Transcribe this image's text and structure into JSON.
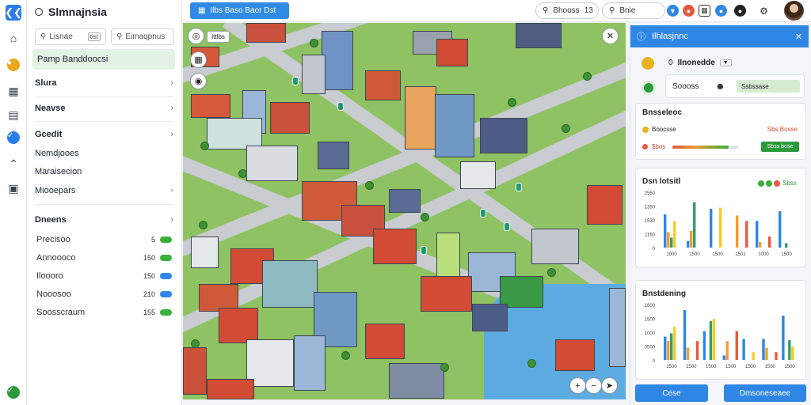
{
  "app": {
    "title": "Slmnajnsia"
  },
  "sidebar": {
    "search_left": "Lisnae",
    "search_left_chip": "tist",
    "search_right": "Eimaqpnus",
    "selected": "Pamp Banddoocsi",
    "nav": [
      {
        "label": "Slura",
        "bold": true,
        "chevron": true
      },
      {
        "label": "Neavse",
        "bold": true,
        "chevron": true
      },
      {
        "label": "Gcedit",
        "bold": true,
        "chevron": true
      },
      {
        "label": "Nemdjooes",
        "bold": false,
        "chevron": false
      },
      {
        "label": "Maraisecion",
        "bold": false,
        "chevron": false
      },
      {
        "label": "Miooepars",
        "bold": false,
        "chevron": true
      },
      {
        "label": "Dneens",
        "bold": true,
        "chevron": true
      }
    ],
    "list": [
      {
        "label": "Precisoo",
        "value": "5",
        "color": "#3cae3c"
      },
      {
        "label": "Annoooco",
        "value": "150",
        "color": "#3cae3c"
      },
      {
        "label": "Iloooro",
        "value": "150",
        "color": "#2f86e4"
      },
      {
        "label": "Nooosoo",
        "value": "210",
        "color": "#2f86e4"
      },
      {
        "label": "Soosscraum",
        "value": "155",
        "color": "#3cae3c"
      }
    ]
  },
  "header": {
    "primary_button": "Ilbs Baso Baor Dst",
    "search1": "Bhooss",
    "search1_num": "13",
    "search2": "Bnie"
  },
  "map": {
    "label": "Ittlbs",
    "left_controls": [
      "location-icon",
      "layers-icon",
      "pin-icon"
    ],
    "bottom_controls": [
      "zoom-in-icon",
      "zoom-out-icon",
      "compass-icon"
    ]
  },
  "panel": {
    "title": "Ilhlasjnnc",
    "dropdown_label": "Ilnonedde",
    "dropdown_num": "0",
    "field1": "Soooss",
    "field2": "Ssbssase",
    "info_title": "Bnsseleoc",
    "row1_left": "Boocsse",
    "row1_right": "Sbs Bosse",
    "row2_left": "$bos",
    "row2_button": "Sbss bose",
    "progress": 0.85,
    "chart1_title": "Dsn lotsitl",
    "chart1_legend": "Sbss",
    "chart2_title": "Bnstdening",
    "buttons": [
      "Cese",
      "Dmsoneseaee"
    ]
  },
  "chart_data": [
    {
      "type": "bar",
      "title": "Dsn lotsitl",
      "yticks": [
        "2550",
        "1350",
        "1530",
        "1150",
        "0"
      ],
      "categories": [
        "1000",
        "1500",
        "1500",
        "1501",
        "1000",
        "1500"
      ],
      "ylim": [
        0,
        100
      ],
      "series": [
        {
          "name": "Sbss",
          "color": "#2f86e4",
          "values": [
            60,
            12,
            70,
            0,
            48,
            66
          ]
        },
        {
          "color": "#f39c34",
          "values": [
            28,
            30,
            0,
            58,
            10,
            0
          ]
        },
        {
          "color": "#2ea06a",
          "values": [
            18,
            82,
            0,
            0,
            0,
            8
          ]
        },
        {
          "color": "#f3cd2c",
          "values": [
            48,
            0,
            72,
            0,
            0,
            0
          ]
        },
        {
          "color": "#e65a3f",
          "values": [
            0,
            0,
            0,
            48,
            20,
            0
          ]
        }
      ]
    },
    {
      "type": "bar",
      "title": "Bnstdening",
      "yticks": [
        "1600",
        "1500",
        "1000",
        "0500",
        "0"
      ],
      "categories": [
        "1500",
        "1500",
        "1500",
        "1500",
        "1500",
        "1500",
        "1500"
      ],
      "ylim": [
        0,
        100
      ],
      "series": [
        {
          "color": "#2f86e4",
          "values": [
            42,
            90,
            52,
            8,
            38,
            38,
            80
          ]
        },
        {
          "color": "#f39c34",
          "values": [
            34,
            22,
            0,
            34,
            0,
            22,
            0
          ]
        },
        {
          "color": "#2ea06a",
          "values": [
            48,
            0,
            70,
            0,
            0,
            0,
            36
          ]
        },
        {
          "color": "#f3cd2c",
          "values": [
            60,
            0,
            74,
            0,
            14,
            0,
            24
          ]
        },
        {
          "color": "#e65a3f",
          "values": [
            0,
            34,
            0,
            52,
            0,
            14,
            0
          ]
        }
      ]
    }
  ]
}
